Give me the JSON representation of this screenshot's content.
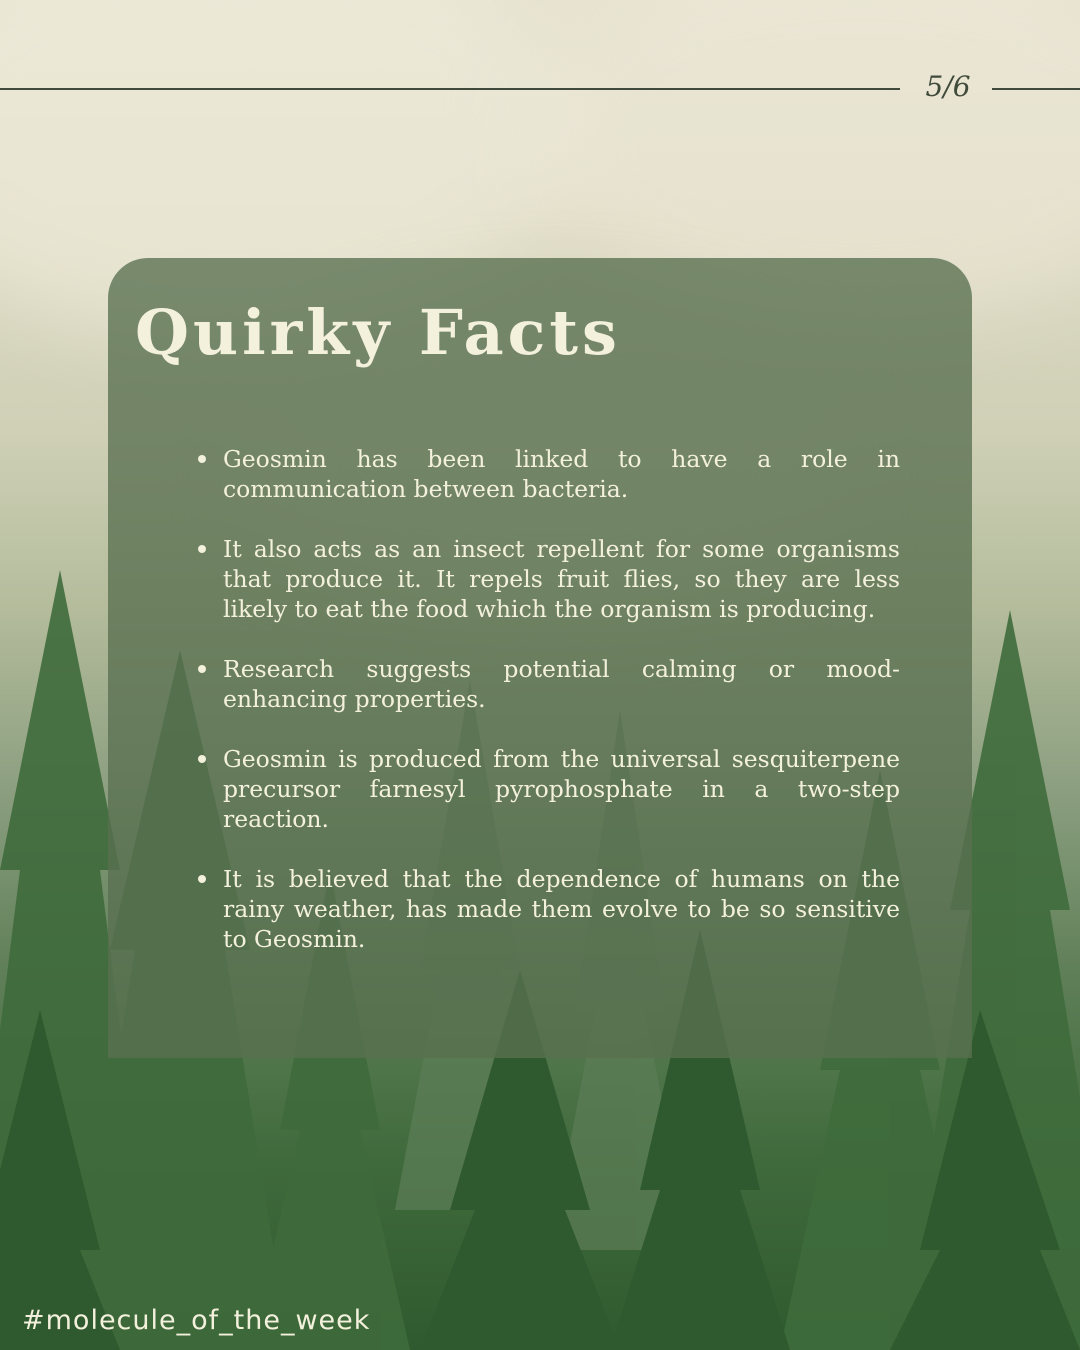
{
  "page": {
    "page_number": "5/6",
    "title": "Quirky Facts",
    "facts": [
      "Geosmin has been linked to have a role in communication between bacteria.",
      "It also acts as an insect repellent for some organisms that produce it. It repels fruit flies, so they are less likely to eat the food which the organism is producing.",
      "Research suggests potential calming or mood-enhancing properties.",
      "Geosmin is produced from the universal sesquiterpene precursor farnesyl pyrophosphate in a two-step reaction.",
      "It is believed that the dependence of humans on the rainy weather, has made them evolve to be so sensitive to Geosmin."
    ],
    "hashtag": "#molecule_of_the_week"
  },
  "colors": {
    "text": "#f3f0dc",
    "card": "#587050",
    "rule": "#3f4a3a"
  }
}
